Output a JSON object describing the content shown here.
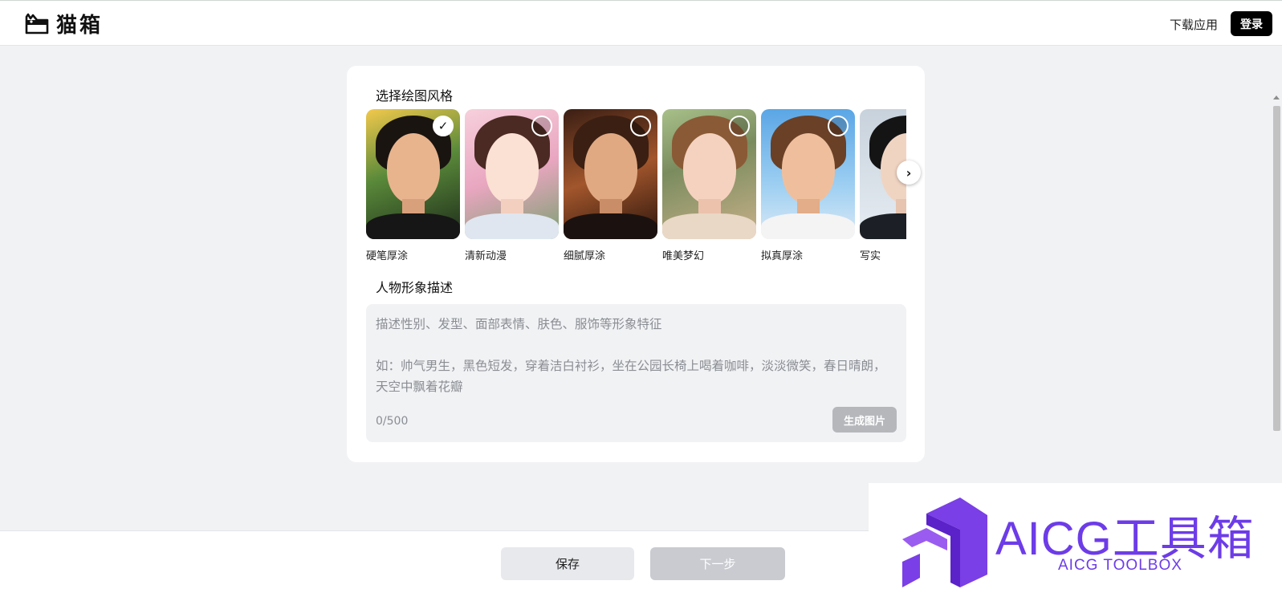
{
  "header": {
    "logo_text": "猫箱",
    "download_label": "下载应用",
    "login_label": "登录"
  },
  "style_section": {
    "title": "选择绘图风格",
    "styles": [
      {
        "label": "硬笔厚涂",
        "selected": true,
        "icon": "portrait-image"
      },
      {
        "label": "清新动漫",
        "selected": false,
        "icon": "portrait-image"
      },
      {
        "label": "细腻厚涂",
        "selected": false,
        "icon": "portrait-image"
      },
      {
        "label": "唯美梦幻",
        "selected": false,
        "icon": "portrait-image"
      },
      {
        "label": "拟真厚涂",
        "selected": false,
        "icon": "portrait-image"
      },
      {
        "label": "写实",
        "selected": false,
        "icon": "portrait-image"
      }
    ],
    "next_icon": "chevron-right-icon",
    "check_icon": "✓",
    "next_glyph": "›"
  },
  "description_section": {
    "title": "人物形象描述",
    "placeholder": "描述性别、发型、面部表情、肤色、服饰等形象特征\n\n如：帅气男生，黑色短发，穿着洁白衬衫，坐在公园长椅上喝着咖啡，淡淡微笑，春日晴朗，天空中飘着花瓣",
    "char_count": "0/500",
    "generate_label": "生成图片"
  },
  "footer": {
    "save_label": "保存",
    "next_label": "下一步"
  },
  "watermark": {
    "title": "AICG工具箱",
    "subtitle": "AICG TOOLBOX"
  },
  "colors": {
    "accent": "#000000",
    "watermark": "#6d3ce8",
    "disabled": "#c9cbd1"
  }
}
